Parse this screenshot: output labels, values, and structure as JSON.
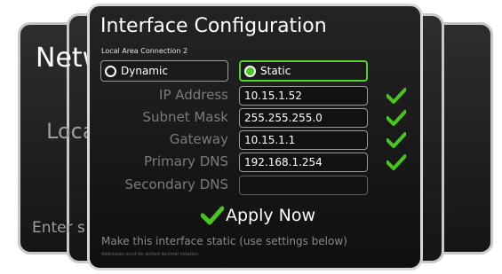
{
  "background": {
    "title": "Netw",
    "subtitle": "Loca",
    "footer": "Enter s"
  },
  "panel": {
    "title": "Interface Configuration",
    "connection": "Local Area Connection 2",
    "modes": {
      "dynamic": "Dynamic",
      "static": "Static",
      "selected": "static"
    },
    "fields": [
      {
        "label": "IP Address",
        "value": "10.15.1.52",
        "valid": true
      },
      {
        "label": "Subnet Mask",
        "value": "255.255.255.0",
        "valid": true
      },
      {
        "label": "Gateway",
        "value": "10.15.1.1",
        "valid": true
      },
      {
        "label": "Primary DNS",
        "value": "192.168.1.254",
        "valid": true
      },
      {
        "label": "Secondary DNS",
        "value": "",
        "valid": false
      }
    ],
    "apply_label": "Apply Now",
    "hint": "Make this interface static (use settings below)",
    "subhint": "Addresses must be dotted decimal notation."
  },
  "colors": {
    "accent_green": "#53d22c",
    "check_green": "#4cc41f"
  }
}
